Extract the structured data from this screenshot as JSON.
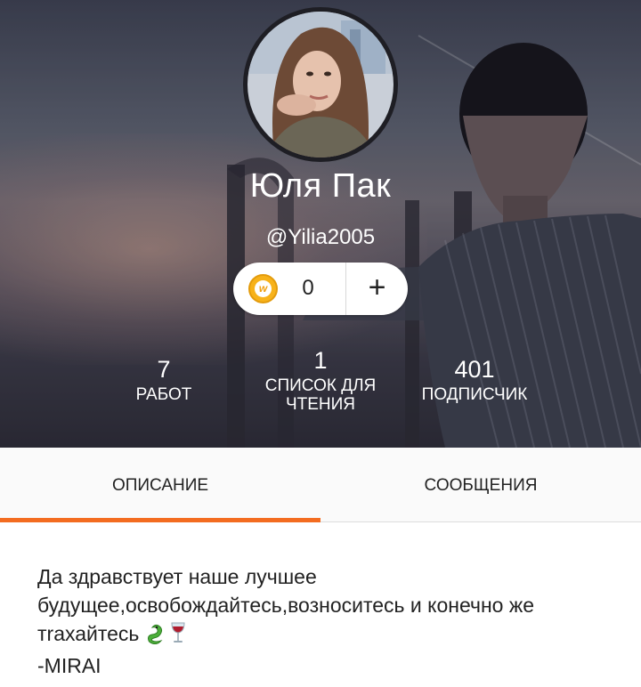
{
  "profile": {
    "name": "Юля Пак",
    "handle": "@Yilia2005"
  },
  "coins": {
    "count": "0",
    "add_label": "+",
    "icon": "wattpad-coin-icon",
    "icon_letter": "w"
  },
  "stats": {
    "works": {
      "value": "7",
      "label": "РАБОТ"
    },
    "reading_lists": {
      "value": "1",
      "label_line1": "СПИСОК ДЛЯ",
      "label_line2": "ЧТЕНИЯ"
    },
    "followers": {
      "value": "401",
      "label": "ПОДПИСЧИК"
    }
  },
  "tabs": [
    {
      "label": "ОПИСАНИЕ",
      "active": true
    },
    {
      "label": "СООБЩЕНИЯ",
      "active": false
    }
  ],
  "description": {
    "line1": "Да здравствует наше лучшее",
    "line2": "будущее,освобождайтесь,возноситесь и конечно же",
    "line3": "тrахайтесь",
    "emojis": [
      "snake-emoji",
      "wine-glass-emoji"
    ],
    "line4": "-MIRAI"
  },
  "colors": {
    "accent": "#f36c20",
    "coin": "#f7b21a"
  }
}
